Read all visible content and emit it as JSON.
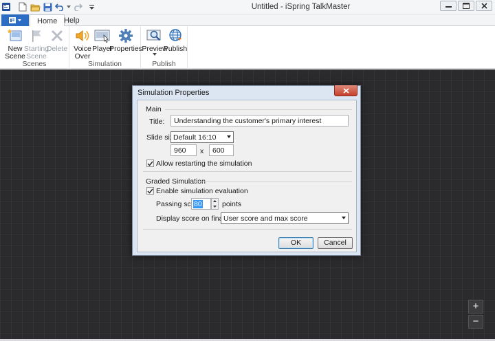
{
  "window": {
    "title": "Untitled - iSpring TalkMaster"
  },
  "ribbon_tabs": [
    {
      "label": "Home"
    },
    {
      "label": "Help"
    }
  ],
  "groups": {
    "scenes": {
      "label": "Scenes",
      "new_scene": "New\nScene",
      "starting_scene": "Starting\nScene",
      "delete": "Delete"
    },
    "simulation": {
      "label": "Simulation",
      "voice_over": "Voice\nOver",
      "player": "Player",
      "properties": "Properties"
    },
    "publish": {
      "label": "Publish",
      "preview": "Preview",
      "publish": "Publish"
    }
  },
  "dialog": {
    "title": "Simulation Properties",
    "main": {
      "section": "Main",
      "title_label": "Title:",
      "title_value": "Understanding the customer's primary interest",
      "slide_size_label": "Slide size:",
      "slide_size_value": "Default 16:10",
      "width": "960",
      "x_sep": "x",
      "height": "600",
      "allow_restart_label": "Allow restarting the simulation",
      "allow_restart_checked": true
    },
    "graded": {
      "section": "Graded Simulation",
      "enable_eval_label": "Enable simulation evaluation",
      "enable_eval_checked": true,
      "passing_score_label": "Passing score:",
      "passing_score_value": "80",
      "points_label": "points",
      "display_score_label": "Display score on final scene:",
      "display_score_value": "User score and max score"
    },
    "ok": "OK",
    "cancel": "Cancel"
  },
  "zoom": {
    "plus": "+",
    "minus": "−"
  },
  "colors": {
    "canvas": "#2b2b2d",
    "file_button": "#2b6cc4",
    "dialog_frame": "#dce6f2"
  }
}
